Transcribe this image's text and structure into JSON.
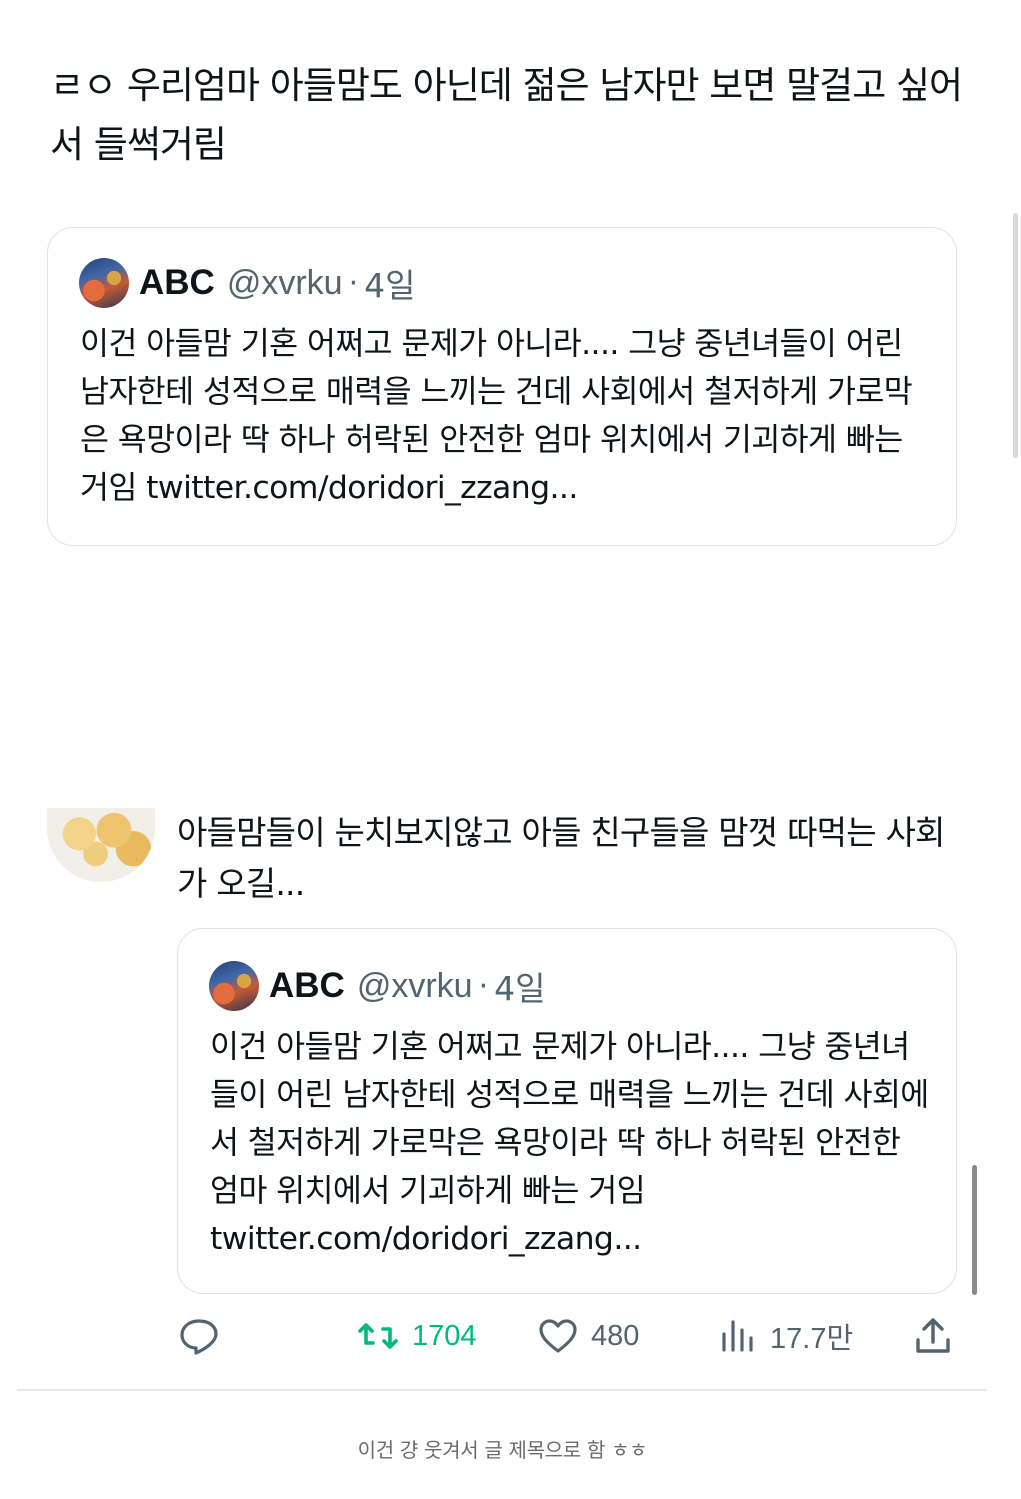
{
  "tweet1": {
    "text": "ㄹㅇ 우리엄마 아들맘도 아닌데 젊은 남자만 보면 말걸고 싶어서 들썩거림"
  },
  "quoted_tweet": {
    "name": "ABC",
    "handle": "@xvrku",
    "separator": "·",
    "age": "4일",
    "text": "이건 아들맘 기혼 어쩌고 문제가 아니라.... 그냥 중년녀들이 어린 남자한테 성적으로 매력을 느끼는 건데 사회에서 철저하게 가로막은 욕망이라 딱 하나 허락된 안전한 엄마 위치에서 기괴하게 빠는 거임 twitter.com/doridori_zzang..."
  },
  "tweet2": {
    "text": "아들맘들이 눈치보지않고 아들 친구들을 맘껏 따먹는 사회가 오길..."
  },
  "actions": {
    "reply_icon": "reply-icon",
    "retweet_icon": "retweet-icon",
    "retweets": "1704",
    "like_icon": "heart-icon",
    "likes": "480",
    "views_icon": "views-icon",
    "views": "17.7만",
    "share_icon": "share-icon",
    "retweet_color": "#00ba7c",
    "muted_color": "#536471"
  },
  "caption": "이건 걍 웃겨서 글 제목으로 함 ㅎㅎ"
}
